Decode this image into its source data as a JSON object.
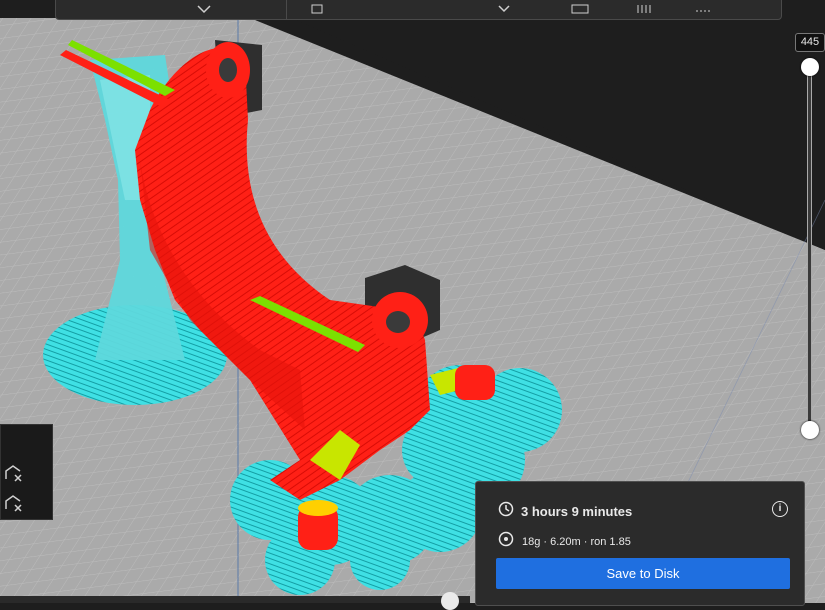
{
  "layer_slider": {
    "current_layer": "445"
  },
  "estimate": {
    "time": "3 hours 9 minutes",
    "material": "18g · 6.20m · ron 1.85"
  },
  "save_button_label": "Save to Disk",
  "colors": {
    "wall_outer": "#ff1a12",
    "wall_inner": "#7ce000",
    "support": "#29d2d8",
    "build_plate": "#a9a9a9",
    "accent": "#1f6fe0"
  }
}
